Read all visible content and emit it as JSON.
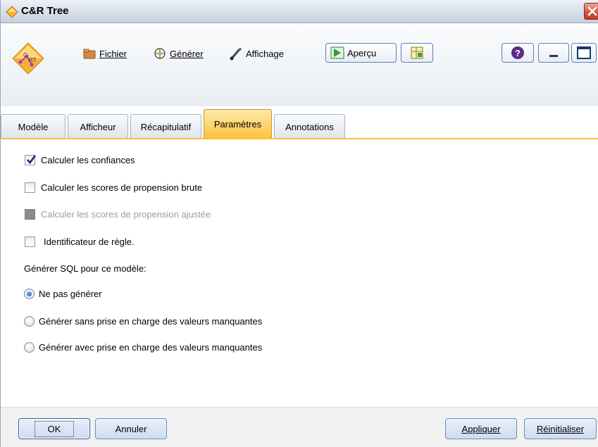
{
  "window": {
    "title": "C&R Tree",
    "accent": "#fbc23e"
  },
  "toolbar": {
    "fichier_label": "Fichier",
    "generer_label": "Générer",
    "affichage_label": "Affichage",
    "apercu_label": "Aperçu"
  },
  "tabs": [
    {
      "label": "Modèle"
    },
    {
      "label": "Afficheur"
    },
    {
      "label": "Récapitulatif"
    },
    {
      "label": "Paramètres",
      "active": true
    },
    {
      "label": "Annotations"
    }
  ],
  "settings": {
    "calc_confidences": {
      "label": "Calculer les confiances",
      "checked": true
    },
    "raw_propensity": {
      "label": "Calculer les scores de propension brute",
      "checked": false
    },
    "adjusted_propensity": {
      "label": "Calculer les scores de propension ajustée",
      "checked": false,
      "disabled": true
    },
    "rule_identifier": {
      "label": "Identificateur de règle.",
      "checked": false
    },
    "sql_heading": "Générer SQL pour ce modèle:",
    "sql_options": [
      {
        "label": "Ne pas générer",
        "selected": true
      },
      {
        "label": "Générer sans prise en charge des valeurs manquantes",
        "selected": false
      },
      {
        "label": "Générer avec prise en charge des valeurs manquantes",
        "selected": false
      }
    ]
  },
  "footer": {
    "ok_label": "OK",
    "cancel_label": "Annuler",
    "apply_label": "Appliquer",
    "reset_label": "Réinitialiser"
  }
}
